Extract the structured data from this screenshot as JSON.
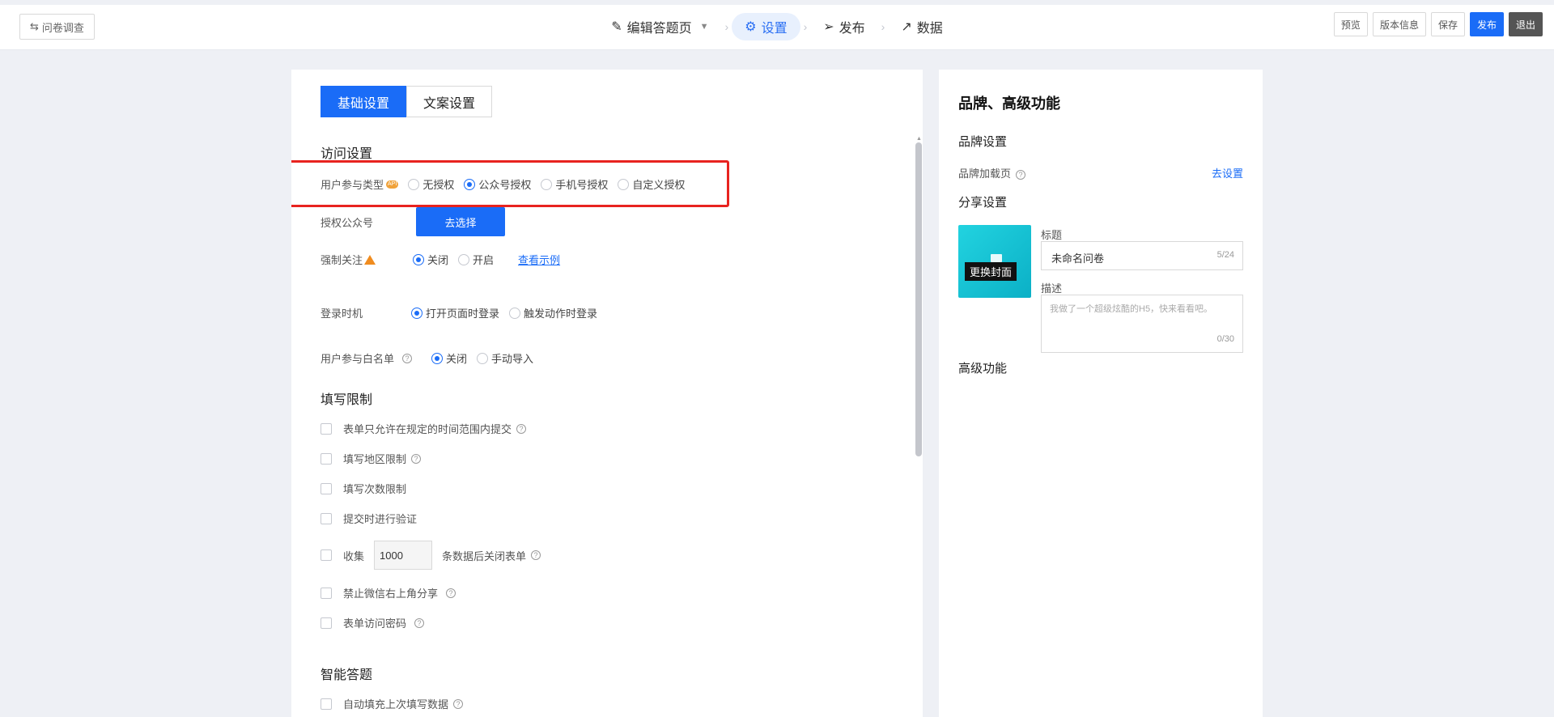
{
  "topbar": {
    "back_label": "问卷调查",
    "steps": [
      {
        "label": "编辑答题页"
      },
      {
        "label": "设置"
      },
      {
        "label": "发布"
      },
      {
        "label": "数据"
      }
    ],
    "actions": {
      "preview": "预览",
      "version": "版本信息",
      "save": "保存",
      "publish": "发布",
      "exit": "退出"
    }
  },
  "main": {
    "tabs": [
      "基础设置",
      "文案设置"
    ],
    "access": {
      "title": "访问设置",
      "user_type_label": "用户参与类型",
      "badge": "API",
      "user_type_options": [
        "无授权",
        "公众号授权",
        "手机号授权",
        "自定义授权"
      ],
      "user_type_selected": "公众号授权",
      "auth_account_label": "授权公众号",
      "auth_account_button": "去选择",
      "force_follow_label": "强制关注",
      "force_follow_options": [
        "关闭",
        "开启"
      ],
      "force_follow_selected": "关闭",
      "example_link": "查看示例",
      "login_time_label": "登录时机",
      "login_time_options": [
        "打开页面时登录",
        "触发动作时登录"
      ],
      "login_time_selected": "打开页面时登录",
      "whitelist_label": "用户参与白名单",
      "whitelist_options": [
        "关闭",
        "手动导入"
      ],
      "whitelist_selected": "关闭"
    },
    "limits": {
      "title": "填写限制",
      "items": {
        "time_range": "表单只允许在规定的时间范围内提交",
        "region": "填写地区限制",
        "count": "填写次数限制",
        "verify": "提交时进行验证",
        "collect_prefix": "收集",
        "collect_value": "1000",
        "collect_suffix": "条数据后关闭表单",
        "no_share": "禁止微信右上角分享",
        "password": "表单访问密码"
      }
    },
    "smart": {
      "title": "智能答题",
      "autofill": "自动填充上次填写数据"
    }
  },
  "side": {
    "title": "品牌、高级功能",
    "brand_title": "品牌设置",
    "brand_loading_label": "品牌加载页",
    "brand_loading_link": "去设置",
    "share_title": "分享设置",
    "cover_label": "更换封面",
    "share_title_label": "标题",
    "share_title_value": "未命名问卷",
    "share_title_count": "5/24",
    "share_desc_label": "描述",
    "share_desc_placeholder": "我做了一个超级炫酷的H5，快来看看吧。",
    "share_desc_count": "0/30",
    "advanced_title": "高级功能"
  }
}
